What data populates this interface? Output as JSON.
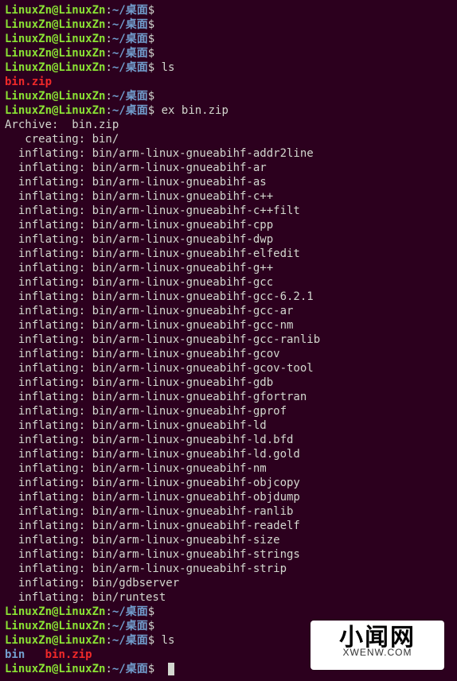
{
  "prompt": {
    "user": "LinuxZn@LinuxZn",
    "colon": ":",
    "path": "~/桌面",
    "dollar": "$"
  },
  "commands": {
    "blank": "",
    "ls": " ls",
    "ex": " ex bin.zip"
  },
  "files": {
    "bin_zip": "bin.zip",
    "bin_dir": "bin",
    "spacer": "   "
  },
  "archive": {
    "header": "Archive:  bin.zip",
    "creating": "   creating: bin/",
    "inflating": [
      "  inflating: bin/arm-linux-gnueabihf-addr2line",
      "  inflating: bin/arm-linux-gnueabihf-ar",
      "  inflating: bin/arm-linux-gnueabihf-as",
      "  inflating: bin/arm-linux-gnueabihf-c++",
      "  inflating: bin/arm-linux-gnueabihf-c++filt",
      "  inflating: bin/arm-linux-gnueabihf-cpp",
      "  inflating: bin/arm-linux-gnueabihf-dwp",
      "  inflating: bin/arm-linux-gnueabihf-elfedit",
      "  inflating: bin/arm-linux-gnueabihf-g++",
      "  inflating: bin/arm-linux-gnueabihf-gcc",
      "  inflating: bin/arm-linux-gnueabihf-gcc-6.2.1",
      "  inflating: bin/arm-linux-gnueabihf-gcc-ar",
      "  inflating: bin/arm-linux-gnueabihf-gcc-nm",
      "  inflating: bin/arm-linux-gnueabihf-gcc-ranlib",
      "  inflating: bin/arm-linux-gnueabihf-gcov",
      "  inflating: bin/arm-linux-gnueabihf-gcov-tool",
      "  inflating: bin/arm-linux-gnueabihf-gdb",
      "  inflating: bin/arm-linux-gnueabihf-gfortran",
      "  inflating: bin/arm-linux-gnueabihf-gprof",
      "  inflating: bin/arm-linux-gnueabihf-ld",
      "  inflating: bin/arm-linux-gnueabihf-ld.bfd",
      "  inflating: bin/arm-linux-gnueabihf-ld.gold",
      "  inflating: bin/arm-linux-gnueabihf-nm",
      "  inflating: bin/arm-linux-gnueabihf-objcopy",
      "  inflating: bin/arm-linux-gnueabihf-objdump",
      "  inflating: bin/arm-linux-gnueabihf-ranlib",
      "  inflating: bin/arm-linux-gnueabihf-readelf",
      "  inflating: bin/arm-linux-gnueabihf-size",
      "  inflating: bin/arm-linux-gnueabihf-strings",
      "  inflating: bin/arm-linux-gnueabihf-strip",
      "  inflating: bin/gdbserver",
      "  inflating: bin/runtest"
    ]
  },
  "watermark": {
    "title": "小闻网",
    "sub": "XWENW.COM"
  }
}
